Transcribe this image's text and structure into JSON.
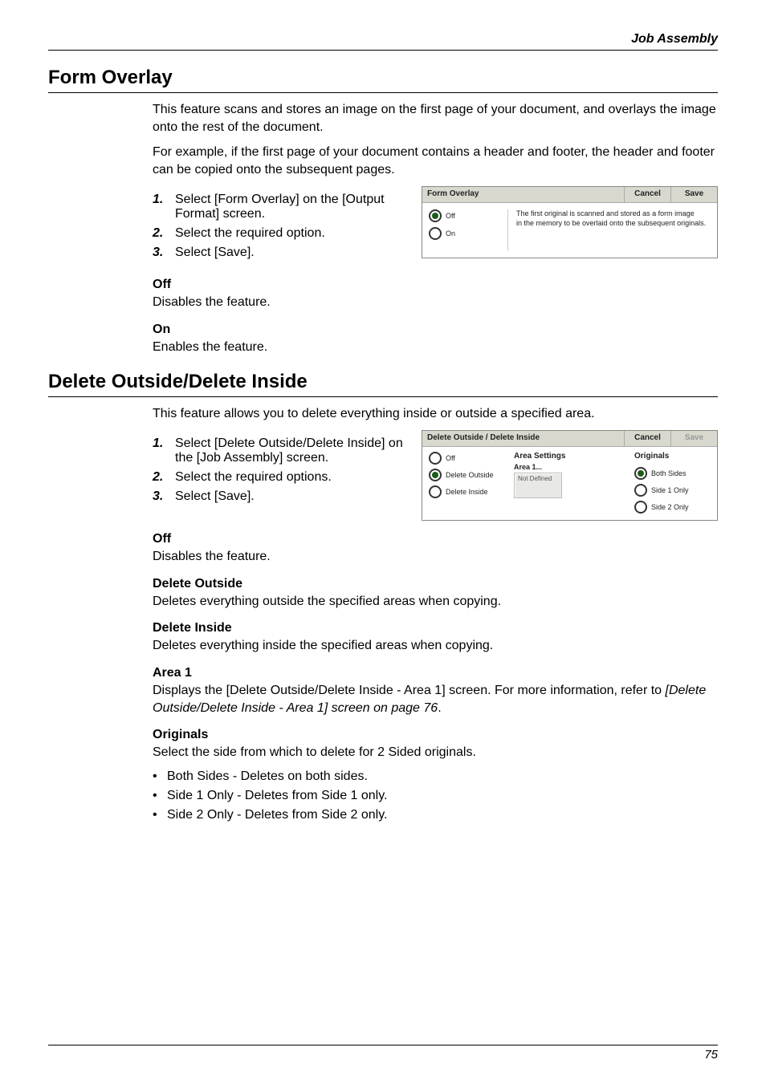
{
  "header": {
    "section": "Job Assembly"
  },
  "section1": {
    "title": "Form Overlay",
    "para1": "This feature scans and stores an image on the first page of your document, and overlays the image onto the rest of the document.",
    "para2": "For example, if the first page of your document contains a header and footer, the header and footer can be copied onto the subsequent pages.",
    "steps": [
      "Select [Form Overlay] on the [Output Format] screen.",
      "Select the required option.",
      "Select [Save]."
    ],
    "off_head": "Off",
    "off_text": "Disables the feature.",
    "on_head": "On",
    "on_text": "Enables the feature.",
    "panel": {
      "title": "Form Overlay",
      "cancel": "Cancel",
      "save": "Save",
      "radios": [
        "Off",
        "On"
      ],
      "desc1": "The first original is scanned and stored as a form image",
      "desc2": "in the memory to be overlaid onto the subsequent originals."
    }
  },
  "section2": {
    "title": "Delete Outside/Delete Inside",
    "para1": "This feature allows you to delete everything inside or outside a specified area.",
    "steps": [
      "Select [Delete Outside/Delete Inside] on the [Job Assembly] screen.",
      "Select the required options.",
      "Select [Save]."
    ],
    "off_head": "Off",
    "off_text": "Disables the feature.",
    "del_out_head": "Delete Outside",
    "del_out_text": "Deletes everything outside the specified areas when copying.",
    "del_in_head": "Delete Inside",
    "del_in_text": "Deletes everything inside the specified areas when copying.",
    "area1_head": "Area 1",
    "area1_text_a": "Displays the [Delete Outside/Delete Inside - Area 1] screen. For more information, refer to ",
    "area1_text_b": "[Delete Outside/Delete Inside - Area 1] screen on page 76",
    "area1_text_c": ".",
    "originals_head": "Originals",
    "originals_text": "Select the side from which to delete for 2 Sided originals.",
    "bullets": [
      "Both Sides - Deletes on both sides.",
      "Side 1 Only - Deletes from Side 1 only.",
      "Side 2 Only - Deletes from Side 2 only."
    ],
    "panel": {
      "title": "Delete Outside / Delete Inside",
      "cancel": "Cancel",
      "save": "Save",
      "radios_left": [
        "Off",
        "Delete Outside",
        "Delete Inside"
      ],
      "area_header": "Area Settings",
      "area_label": "Area 1...",
      "area_value": "Not Defined",
      "orig_header": "Originals",
      "radios_right": [
        "Both Sides",
        "Side 1 Only",
        "Side 2 Only"
      ]
    }
  },
  "footer": {
    "page": "75"
  }
}
